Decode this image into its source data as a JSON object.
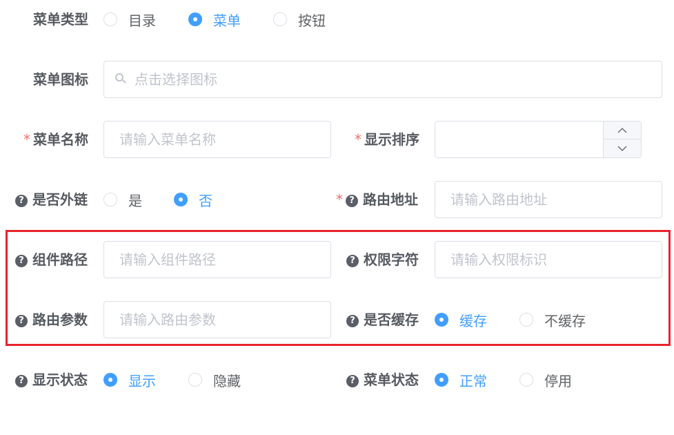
{
  "menu_type": {
    "label": "菜单类型",
    "options": [
      {
        "label": "目录",
        "selected": false
      },
      {
        "label": "菜单",
        "selected": true
      },
      {
        "label": "按钮",
        "selected": false
      }
    ]
  },
  "menu_icon": {
    "label": "菜单图标",
    "placeholder": "点击选择图标",
    "value": ""
  },
  "menu_name": {
    "required": "*",
    "label": "菜单名称",
    "placeholder": "请输入菜单名称",
    "value": ""
  },
  "display_order": {
    "required": "*",
    "label": "显示排序",
    "value": "",
    "up_icon": "chevron-up-icon",
    "down_icon": "chevron-down-icon"
  },
  "external_link": {
    "label": "是否外链",
    "options": [
      {
        "label": "是",
        "selected": false
      },
      {
        "label": "否",
        "selected": true
      }
    ]
  },
  "route_path": {
    "required": "*",
    "label": "路由地址",
    "placeholder": "请输入路由地址",
    "value": ""
  },
  "component_path": {
    "label": "组件路径",
    "placeholder": "请输入组件路径",
    "value": ""
  },
  "permission": {
    "label": "权限字符",
    "placeholder": "请输入权限标识",
    "value": ""
  },
  "route_params": {
    "label": "路由参数",
    "placeholder": "请输入路由参数",
    "value": ""
  },
  "cache": {
    "label": "是否缓存",
    "options": [
      {
        "label": "缓存",
        "selected": true
      },
      {
        "label": "不缓存",
        "selected": false
      }
    ]
  },
  "visible": {
    "label": "显示状态",
    "options": [
      {
        "label": "显示",
        "selected": true
      },
      {
        "label": "隐藏",
        "selected": false
      }
    ]
  },
  "status": {
    "label": "菜单状态",
    "options": [
      {
        "label": "正常",
        "selected": true
      },
      {
        "label": "停用",
        "selected": false
      }
    ]
  },
  "help_icon": {
    "glyph": "?",
    "icon": "question-circle-icon"
  },
  "colors": {
    "accent": "#409eff",
    "required": "#f56c6c",
    "highlight_box": "#e8232b",
    "border": "#dcdfe6",
    "placeholder": "#c0c4cc"
  }
}
